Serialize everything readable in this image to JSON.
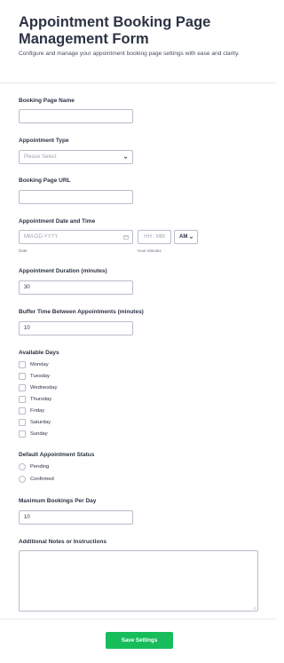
{
  "form": {
    "title": "Appointment Booking Page Management Form",
    "subtitle": "Configure and manage your appointment booking page settings with ease and clarity."
  },
  "fields": {
    "booking_page_name": {
      "label": "Booking Page Name",
      "value": ""
    },
    "appointment_type": {
      "label": "Appointment Type",
      "selected": "Please Select"
    },
    "booking_page_url": {
      "label": "Booking Page URL",
      "value": ""
    },
    "appointment_datetime": {
      "label": "Appointment Date and Time",
      "date_placeholder": "MM-DD-YYYY",
      "date_sublabel": "Date",
      "time_placeholder": "HH : MM",
      "time_sublabel": "Hour Minutes",
      "ampm": "AM"
    },
    "duration": {
      "label": "Appointment Duration (minutes)",
      "value": "30"
    },
    "buffer": {
      "label": "Buffer Time Between Appointments (minutes)",
      "value": "10"
    },
    "available_days": {
      "label": "Available Days",
      "options": [
        "Monday",
        "Tuesday",
        "Wednesday",
        "Thursday",
        "Friday",
        "Saturday",
        "Sunday"
      ]
    },
    "status": {
      "label": "Default Appointment Status",
      "options": [
        "Pending",
        "Confirmed"
      ]
    },
    "max_bookings": {
      "label": "Maximum Bookings Per Day",
      "value": "10"
    },
    "notes": {
      "label": "Additional Notes or Instructions",
      "value": ""
    }
  },
  "submit_label": "Save Settings",
  "colors": {
    "accent": "#18bd5b",
    "border": "#b8bdc9",
    "text": "#2c3345"
  }
}
